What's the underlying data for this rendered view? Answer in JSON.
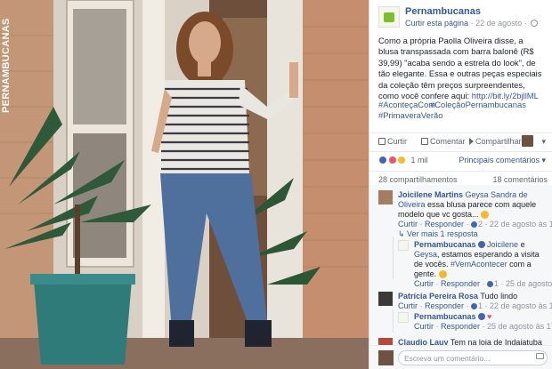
{
  "photo": {
    "watermark": "PERNAMBUCANAS"
  },
  "post": {
    "page_name": "Pernambucanas",
    "follow_label": "Curtir esta página",
    "date": "22 de agosto",
    "caption_text": "Como a própria Paolla Oliveira disse, a blusa transpassada com barra balonê (R$ 39,99) \"acaba sendo a estrela do look\", de tão elegante. Essa e outras peças especiais da coleção têm preços surpreendentes, como você confere aqui:",
    "caption_link": "http://bit.ly/2bjllML",
    "hashtags": [
      "#AconteçaCom",
      "#ColeçãoPernambucanas",
      "#PrimaveraVerão"
    ]
  },
  "actions": {
    "like": "Curtir",
    "comment": "Comentar",
    "share": "Compartilhar"
  },
  "reactions": {
    "count": "1 mil",
    "sort_label": "Principais comentários"
  },
  "counts": {
    "shares": "28 compartilhamentos",
    "comments": "18 comentários"
  },
  "comments": [
    {
      "author": "Joicilene Martins",
      "mention": "Geysa Sandra de Oliveira",
      "text": "essa blusa parece com aquele modelo que vc gosta...",
      "like": "Curtir",
      "reply": "Responder",
      "likes": "2",
      "time": "22 de agosto às 19:53"
    },
    {
      "more_replies": "Ver mais 1 resposta"
    },
    {
      "author": "Pernambucanas",
      "mention1": "Joicilene",
      "mention2": "Geysa",
      "line1": "e",
      "line2": "estamos esperando a visita de vocês.",
      "hashtag": "#VemAcontecer",
      "tail": "com a gente.",
      "like": "Curtir",
      "reply": "Responder",
      "likes": "1",
      "time": "25 de agosto às 17:30"
    },
    {
      "author": "Patrícia Pereira Rosa",
      "text": "Tudo lindo",
      "like": "Curtir",
      "reply": "Responder",
      "likes": "1",
      "time": "22 de agosto às 17:56"
    },
    {
      "author": "Pernambucanas",
      "like": "Curtir",
      "reply": "Responder",
      "time": "25 de agosto às 17:31"
    },
    {
      "author": "Claudio Lauy",
      "text": "Tem na loja de Indaiatuba ?"
    }
  ],
  "compose": {
    "placeholder": "Escreva um comentário..."
  }
}
